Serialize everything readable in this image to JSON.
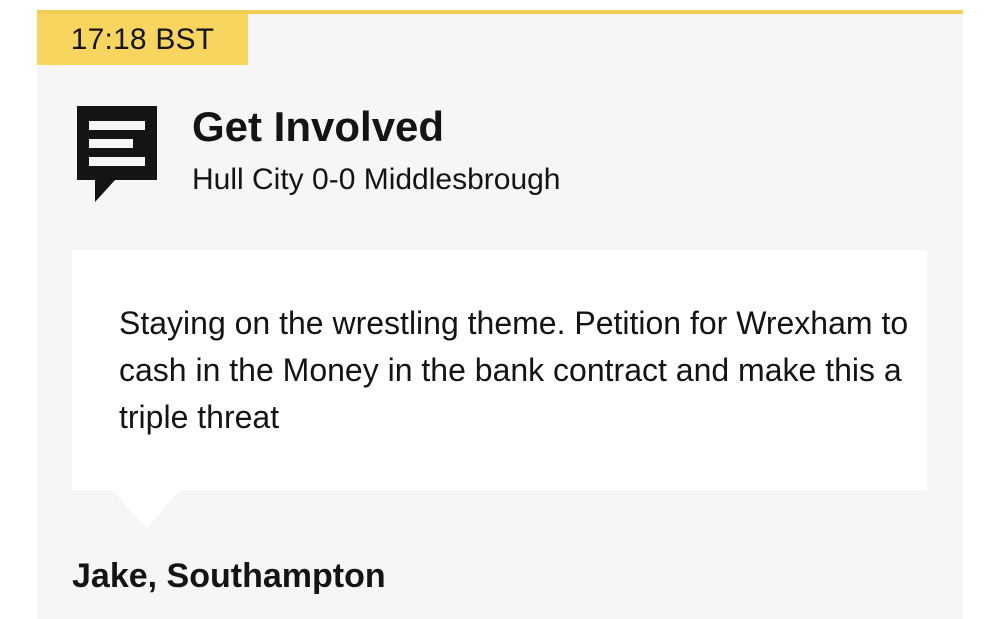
{
  "post": {
    "timestamp": "17:18 BST",
    "header": {
      "icon": "comment-icon",
      "title": "Get Involved",
      "subtitle": "Hull City 0-0 Middlesbrough"
    },
    "quote": {
      "text": "Staying on the wrestling theme. Petition for Wrexham to cash in the Money in the bank contract and make this a triple threat"
    },
    "author": "Jake, Southampton"
  },
  "colors": {
    "accent": "#f7d55e",
    "card_background": "#f6f6f6",
    "quote_background": "#ffffff",
    "text": "#141414"
  }
}
